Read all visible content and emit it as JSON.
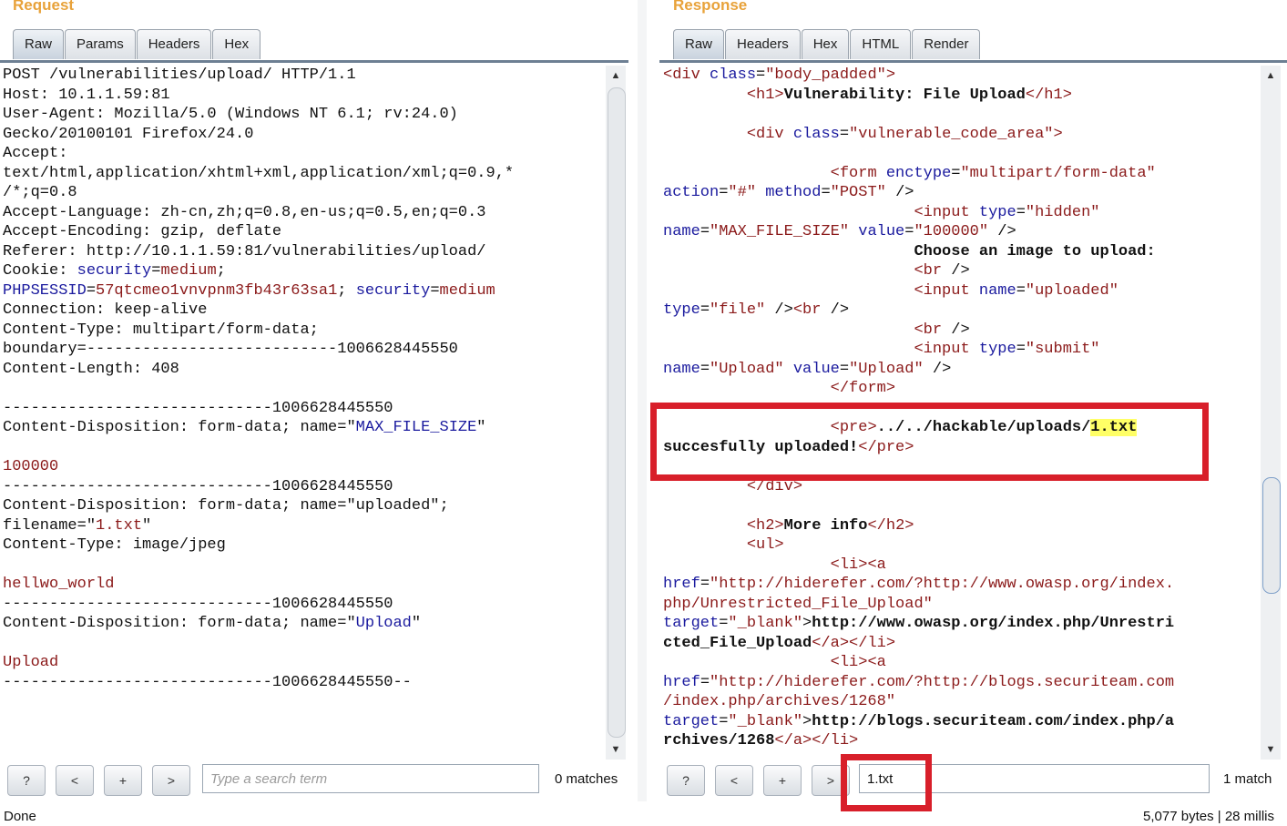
{
  "request": {
    "title": "Request",
    "tabs": [
      "Raw",
      "Params",
      "Headers",
      "Hex"
    ],
    "lines": [
      {
        "t": "POST /vulnerabilities/upload/ HTTP/1.1",
        "s": ""
      },
      {
        "t": "Host: 10.1.1.59:81",
        "s": ""
      },
      {
        "t": "User-Agent: Mozilla/5.0 (Windows NT 6.1; rv:24.0)",
        "s": ""
      },
      {
        "t": "Gecko/20100101 Firefox/24.0",
        "s": ""
      },
      {
        "t": "Accept:",
        "s": ""
      },
      {
        "t": "text/html,application/xhtml+xml,application/xml;q=0.9,*",
        "s": ""
      },
      {
        "t": "/*;q=0.8",
        "s": ""
      },
      {
        "t": "Accept-Language: zh-cn,zh;q=0.8,en-us;q=0.5,en;q=0.3",
        "s": ""
      },
      {
        "t": "Accept-Encoding: gzip, deflate",
        "s": ""
      },
      {
        "t": "Referer: http://10.1.1.59:81/vulnerabilities/upload/",
        "s": ""
      },
      {
        "t": "Cookie: security=medium;",
        "s": "cookie1"
      },
      {
        "t": "PHPSESSID=57qtcmeo1vnvpnm3fb43r63sa1; security=medium",
        "s": "cookie2"
      },
      {
        "t": "Connection: keep-alive",
        "s": ""
      },
      {
        "t": "Content-Type: multipart/form-data;",
        "s": ""
      },
      {
        "t": "boundary=---------------------------1006628445550",
        "s": ""
      },
      {
        "t": "Content-Length: 408",
        "s": ""
      },
      {
        "t": "",
        "s": ""
      },
      {
        "t": "-----------------------------1006628445550",
        "s": ""
      },
      {
        "t": "Content-Disposition: form-data; name=\"MAX_FILE_SIZE\"",
        "s": "cd_max"
      },
      {
        "t": "",
        "s": ""
      },
      {
        "t": "100000",
        "s": "red"
      },
      {
        "t": "-----------------------------1006628445550",
        "s": ""
      },
      {
        "t": "Content-Disposition: form-data; name=\"uploaded\";",
        "s": ""
      },
      {
        "t": "filename=\"1.txt\"",
        "s": "filename"
      },
      {
        "t": "Content-Type: image/jpeg",
        "s": ""
      },
      {
        "t": "",
        "s": ""
      },
      {
        "t": "hellwo_world",
        "s": "red"
      },
      {
        "t": "-----------------------------1006628445550",
        "s": ""
      },
      {
        "t": "Content-Disposition: form-data; name=\"Upload\"",
        "s": "cd_upload"
      },
      {
        "t": "",
        "s": ""
      },
      {
        "t": "Upload",
        "s": "red"
      },
      {
        "t": "-----------------------------1006628445550--",
        "s": ""
      }
    ],
    "search": {
      "placeholder": "Type a search term",
      "value": "",
      "matches": "0 matches"
    },
    "buttons": {
      "help": "?",
      "prev": "<",
      "add": "+",
      "next": ">"
    }
  },
  "response": {
    "title": "Response",
    "tabs": [
      "Raw",
      "Headers",
      "Hex",
      "HTML",
      "Render"
    ],
    "search": {
      "placeholder": "",
      "value": "1.txt",
      "matches": "1 match"
    },
    "buttons": {
      "help": "?",
      "prev": "<",
      "add": "+",
      "next": ">"
    },
    "highlight_term": "1.txt"
  },
  "status": {
    "left": "Done",
    "right": "5,077 bytes | 28 millis"
  },
  "colors": {
    "title": "#e8a23a",
    "annotation_box": "#d81f2a",
    "tag": "#8b1a1a",
    "attr": "#1a1a9e",
    "search_highlight": "#ffff66"
  }
}
